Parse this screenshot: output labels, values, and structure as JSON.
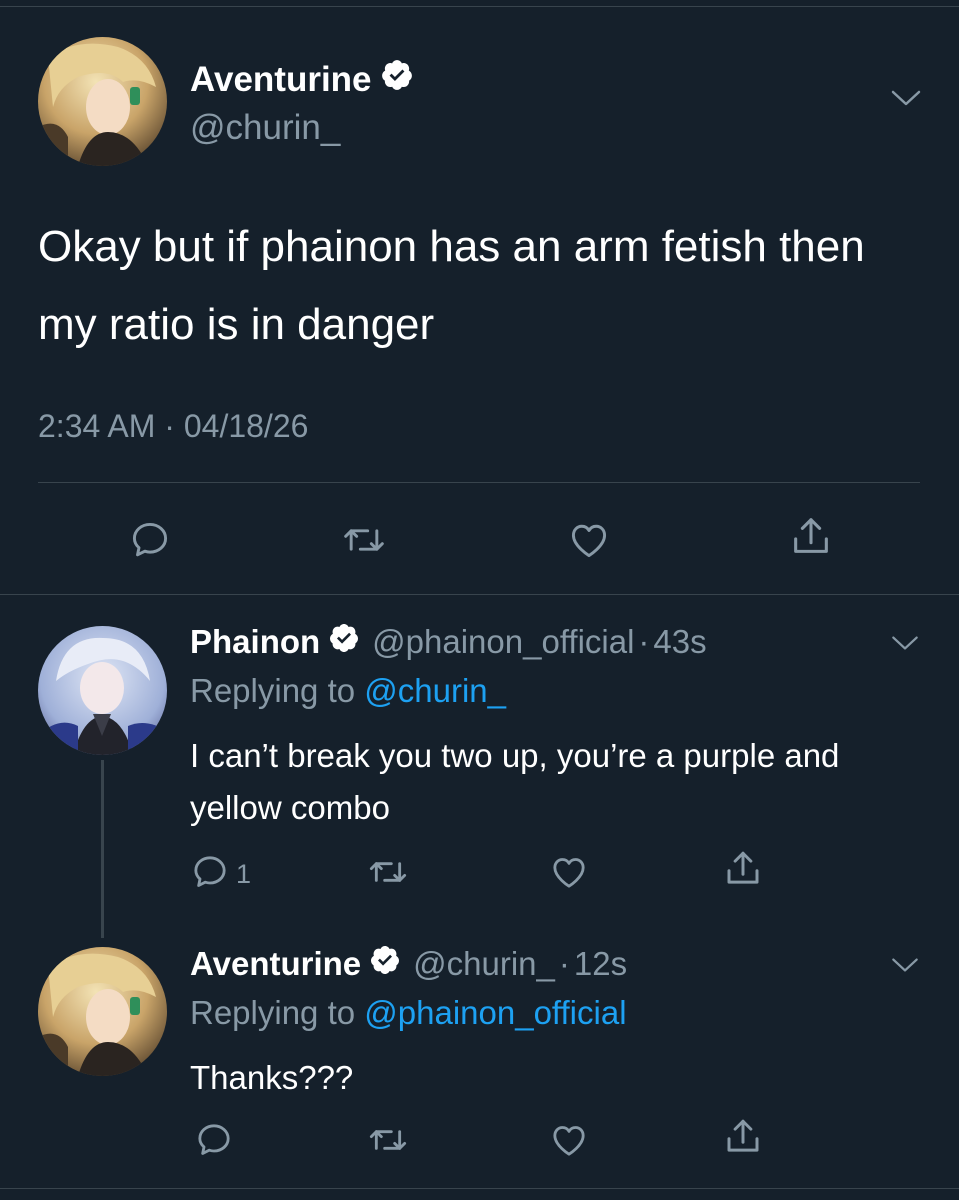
{
  "main_tweet": {
    "author_name": "Aventurine",
    "author_handle": "@churin_",
    "text": "Okay but if phainon has an arm fetish then my ratio is in danger",
    "timestamp": "2:34 AM · 04/18/26",
    "actions": [
      "reply-icon",
      "retweet-icon",
      "like-icon",
      "share-icon"
    ]
  },
  "replies": [
    {
      "author_name": "Phainon",
      "author_handle": "@phainon_official",
      "separator": "·",
      "time": "43s",
      "replying_prefix": "Replying to",
      "replying_to": "@churin_",
      "text": "I can’t break you two up, you’re a purple and yellow combo",
      "reply_count": "1"
    },
    {
      "author_name": "Aventurine",
      "author_handle": "@churin_",
      "separator": "·",
      "time": "12s",
      "replying_prefix": "Replying to",
      "replying_to": "@phainon_official",
      "text": "Thanks???",
      "reply_count": ""
    }
  ],
  "colors": {
    "background": "#15202b",
    "divider": "#38444d",
    "secondary_text": "#8899a6",
    "link": "#1da1f2",
    "icon": "#8899a6"
  }
}
